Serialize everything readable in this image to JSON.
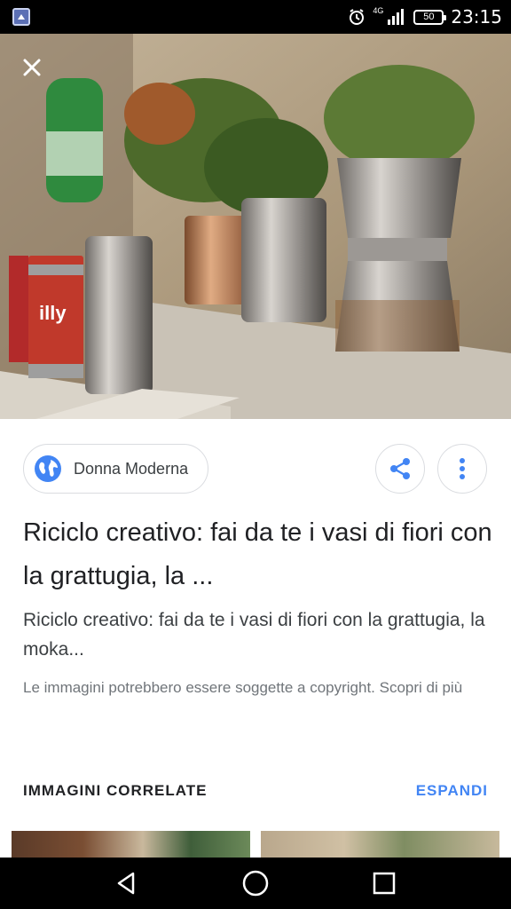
{
  "status_bar": {
    "time": "23:15",
    "network": "4G",
    "battery": "50",
    "icons": [
      "app-notification-icon",
      "alarm-icon",
      "signal-icon",
      "battery-icon"
    ]
  },
  "hero": {
    "description_icon": "close-icon"
  },
  "source": {
    "name": "Donna Moderna",
    "icon": "globe-icon"
  },
  "actions": {
    "share_icon": "share-icon",
    "more_icon": "more-vertical-icon"
  },
  "result": {
    "title": "Riciclo creativo: fai da te i vasi di fiori con la grattugia, la ...",
    "description": "Riciclo creativo: fai da te i vasi di fiori con la grattugia, la moka...",
    "copyright": "Le immagini potrebbero essere soggette a copyright. Scopri di più"
  },
  "related": {
    "title": "IMMAGINI CORRELATE",
    "expand_label": "ESPANDI"
  },
  "nav": {
    "icons": [
      "back-icon",
      "home-icon",
      "recents-icon"
    ]
  },
  "colors": {
    "accent": "#4285f4",
    "title_text": "#202124",
    "secondary_text": "#70757a"
  }
}
